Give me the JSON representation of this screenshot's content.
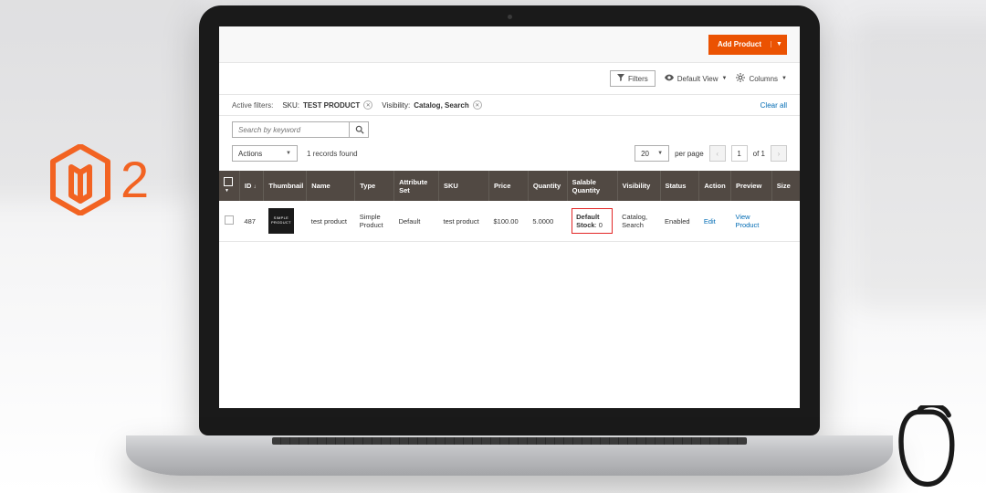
{
  "logo": {
    "suffix": "2"
  },
  "topbar": {
    "add_product": "Add Product"
  },
  "toolbar": {
    "filters": "Filters",
    "default_view": "Default View",
    "columns": "Columns"
  },
  "activeFilters": {
    "label": "Active filters:",
    "items": [
      {
        "key": "SKU:",
        "value": "TEST PRODUCT"
      },
      {
        "key": "Visibility:",
        "value": "Catalog, Search"
      }
    ],
    "clear": "Clear all"
  },
  "search": {
    "placeholder": "Search by keyword"
  },
  "actions": {
    "label": "Actions",
    "records": "1 records found"
  },
  "pager": {
    "perPageValue": "20",
    "perPageLabel": "per page",
    "page": "1",
    "of": "of 1"
  },
  "columns": [
    "",
    "ID",
    "Thumbnail",
    "Name",
    "Type",
    "Attribute Set",
    "SKU",
    "Price",
    "Quantity",
    "Salable Quantity",
    "Visibility",
    "Status",
    "Action",
    "Preview",
    "Size"
  ],
  "row": {
    "id": "487",
    "thumb": "SIMPLE PRODUCT",
    "name": "test product",
    "type": "Simple Product",
    "attrset": "Default",
    "sku": "test product",
    "price": "$100.00",
    "qty": "5.0000",
    "salable_label": "Default Stock",
    "salable_value": ": 0",
    "visibility": "Catalog, Search",
    "status": "Enabled",
    "action": "Edit",
    "preview": "View Product"
  }
}
